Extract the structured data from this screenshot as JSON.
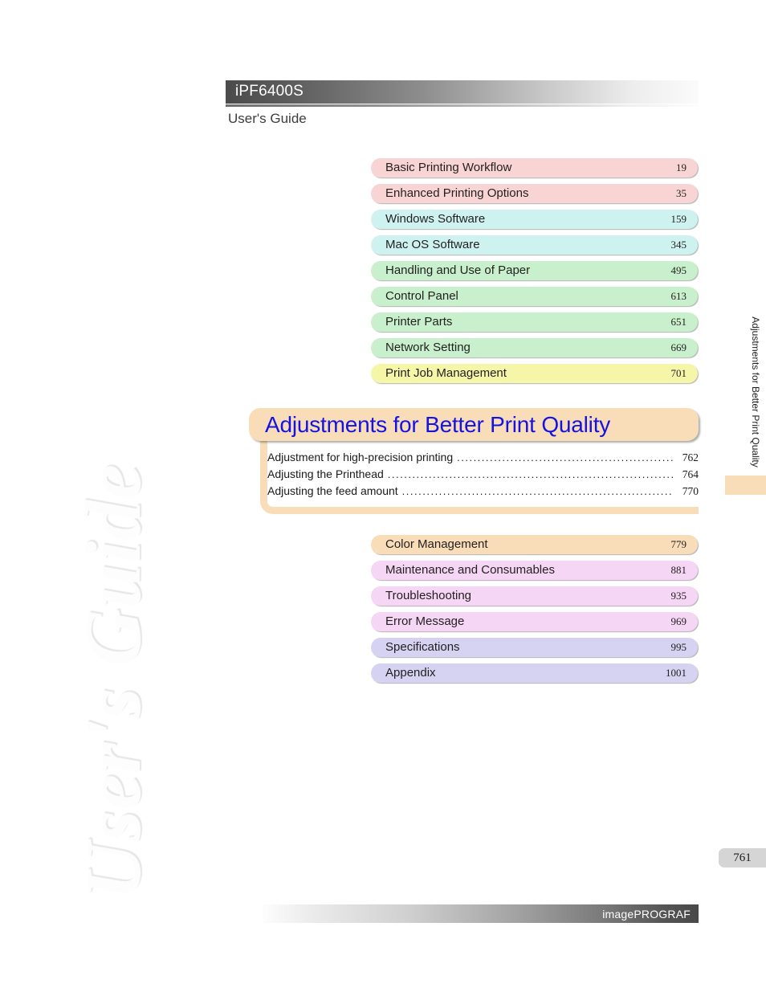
{
  "header": {
    "model": "iPF6400S",
    "subtitle": "User's Guide"
  },
  "watermark": {
    "text": "User's Guide"
  },
  "chapters_top": [
    {
      "label": "Basic Printing Workflow",
      "page": "19",
      "color_class": "c-pink",
      "color": "#f8d4d4"
    },
    {
      "label": "Enhanced Printing Options",
      "page": "35",
      "color_class": "c-pink",
      "color": "#f8d4d4"
    },
    {
      "label": "Windows Software",
      "page": "159",
      "color_class": "c-cyan",
      "color": "#cdf2f0"
    },
    {
      "label": "Mac OS Software",
      "page": "345",
      "color_class": "c-cyan",
      "color": "#cdf2f0"
    },
    {
      "label": "Handling and Use of Paper",
      "page": "495",
      "color_class": "c-green",
      "color": "#c9f0cc"
    },
    {
      "label": "Control Panel",
      "page": "613",
      "color_class": "c-green",
      "color": "#c9f0cc"
    },
    {
      "label": "Printer Parts",
      "page": "651",
      "color_class": "c-green",
      "color": "#c9f0cc"
    },
    {
      "label": "Network Setting",
      "page": "669",
      "color_class": "c-green",
      "color": "#c9f0cc"
    },
    {
      "label": "Print Job Management",
      "page": "701",
      "color_class": "c-yellow",
      "color": "#f6f6a8"
    }
  ],
  "current_chapter": {
    "title": "Adjustments for Better Print Quality",
    "title_color": "#1414e0",
    "banner_color": "#f9ddb9",
    "entries": [
      {
        "title": "Adjustment for high-precision printing",
        "page": "762",
        "dots": "................................................................................................."
      },
      {
        "title": "Adjusting the Printhead",
        "page": "764",
        "dots": "................................................................................................."
      },
      {
        "title": "Adjusting the feed amount",
        "page": "770",
        "dots": "................................................................................................."
      }
    ]
  },
  "chapters_bottom": [
    {
      "label": "Color Management",
      "page": "779",
      "color_class": "c-orange",
      "color": "#f9ddb9"
    },
    {
      "label": "Maintenance and Consumables",
      "page": "881",
      "color_class": "c-magenta",
      "color": "#f5d6f5"
    },
    {
      "label": "Troubleshooting",
      "page": "935",
      "color_class": "c-magenta",
      "color": "#f5d6f5"
    },
    {
      "label": "Error Message",
      "page": "969",
      "color_class": "c-magenta",
      "color": "#f5d6f5"
    },
    {
      "label": "Specifications",
      "page": "995",
      "color_class": "c-lavender",
      "color": "#d6d2f2"
    },
    {
      "label": "Appendix",
      "page": "1001",
      "color_class": "c-lavender",
      "color": "#d6d2f2"
    }
  ],
  "side_tab": {
    "chapter_text": "Adjustments for Better Print Quality",
    "marker_color": "#f9ddb9"
  },
  "page_number": "761",
  "footer": {
    "brand": "imagePROGRAF"
  }
}
